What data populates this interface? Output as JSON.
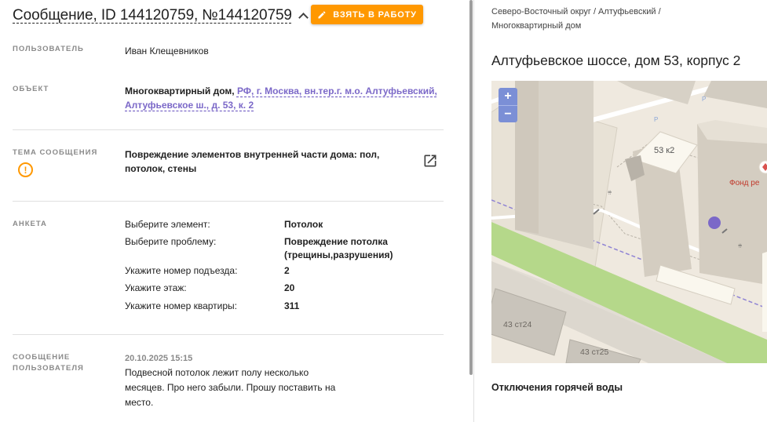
{
  "header": {
    "title": "Сообщение, ID 144120759, №144120759",
    "take_button_label": "ВЗЯТЬ В РАБОТУ"
  },
  "fields": {
    "user_label": "ПОЛЬЗОВАТЕЛЬ",
    "user_value": "Иван Клещевников",
    "object_label": "ОБЪЕКТ",
    "object_type": "Многоквартирный дом,",
    "object_address_line1": "РФ, г. Москва, вн.тер.г. м.о. Алтуфьевский,",
    "object_address_line2": "Алтуфьевское ш., д. 53, к. 2",
    "topic_label": "ТЕМА СООБЩЕНИЯ",
    "topic_line1": "Повреждение элементов внутренней части дома: пол,",
    "topic_line2": "потолок, стены",
    "form_label": "АНКЕТА",
    "message_label_line1": "СООБЩЕНИЕ",
    "message_label_line2": "ПОЛЬЗОВАТЕЛЯ",
    "message_date": "20.10.2025 15:15",
    "message_line1": "Подвесной потолок лежит полу несколько",
    "message_line2": "месяцев. Про него забыли. Прошу поставить на",
    "message_line3": "место."
  },
  "questionnaire": [
    {
      "question": "Выберите элемент:",
      "answer": "Потолок"
    },
    {
      "question": "Выберите проблему:",
      "answer": "Повреждение потолка (трещины,разрушения)"
    },
    {
      "question": "Укажите номер подъезда:",
      "answer": "2"
    },
    {
      "question": "Укажите этаж:",
      "answer": "20"
    },
    {
      "question": "Укажите номер квартиры:",
      "answer": "311"
    }
  ],
  "right": {
    "breadcrumb_line1": "Северо-Восточный округ / Алтуфьевский /",
    "breadcrumb_line2": "Многоквартирный дом",
    "address_title": "Алтуфьевское шоссе, дом 53, корпус 2",
    "outage_heading": "Отключения горячей воды"
  },
  "map": {
    "zoom_in": "+",
    "zoom_out": "−",
    "building_label": "53 к2",
    "label_43_24": "43 ст24",
    "label_43_25": "43 ст25",
    "poi_label": "Фонд ре",
    "parking_label": "P"
  },
  "colors": {
    "accent_orange": "#ff9800",
    "link_purple": "#7b68c8",
    "marker": "#7b68c8"
  }
}
